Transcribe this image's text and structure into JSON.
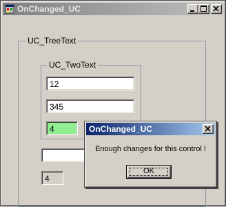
{
  "window": {
    "title": "OnChanged_UC",
    "icon": "app-form-icon",
    "controls": [
      "minimize-icon",
      "maximize-icon",
      "close-icon"
    ]
  },
  "outer_group": {
    "label": "UC_TreeText",
    "inner_group": {
      "label": "UC_TwoText",
      "field1": "12",
      "field2": "345",
      "sum_field": "4",
      "sum_highlight": "#90ee90"
    },
    "input_field": "",
    "readonly_field": "4"
  },
  "dialog": {
    "title": "OnChanged_UC",
    "message": "Enough changes for this control !",
    "ok_label": "OK"
  }
}
